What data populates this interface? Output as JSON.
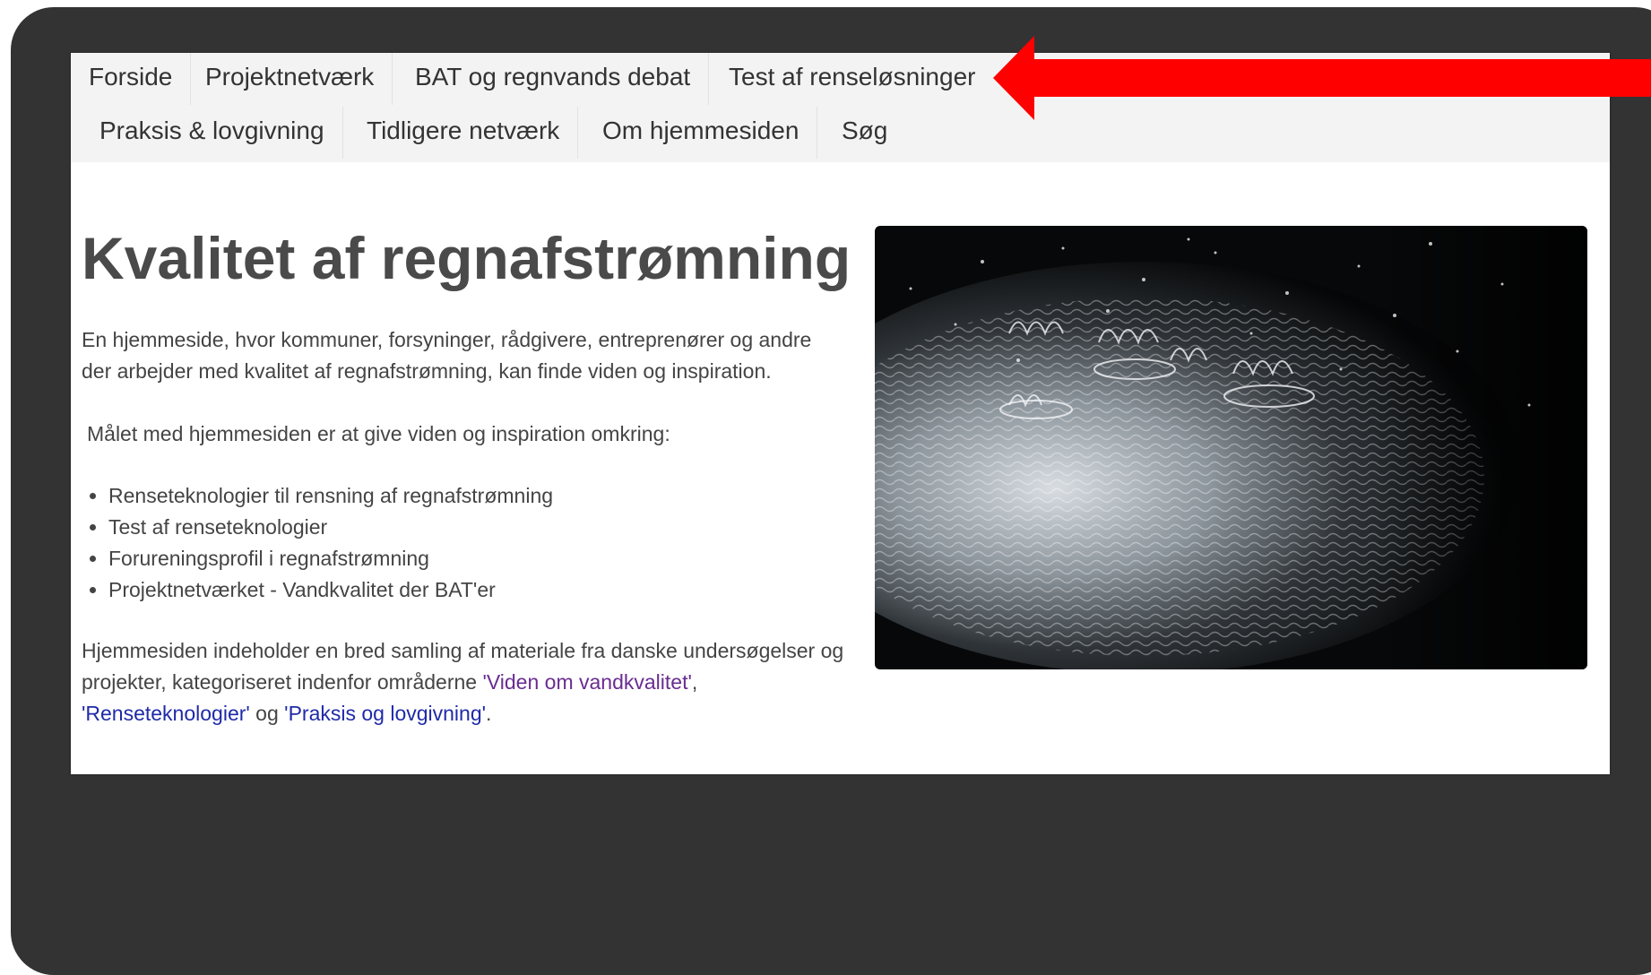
{
  "nav": {
    "row1": [
      "Forside",
      "Projektnetværk",
      "BAT og regnvands debat",
      "Test af renseløsninger"
    ],
    "row2": [
      "Praksis & lovgivning",
      "Tidligere netværk",
      "Om hjemmesiden",
      "Søg"
    ]
  },
  "annotation": {
    "arrow_color": "#ff0000",
    "points_to": "Test af renseløsninger"
  },
  "main": {
    "title": "Kvalitet af regnafstrømning",
    "intro": "En hjemmeside, hvor kommuner, forsyninger, rådgivere, entreprenører og andre der arbejder med kvalitet af regnafstrømning, kan finde viden og inspiration.",
    "goal": "Målet med hjemmesiden er at give viden og inspiration omkring:",
    "bullets": [
      "Renseteknologier til rensning af regnafstrømning",
      "Test af renseteknologier",
      "Forureningsprofil i regnafstrømning",
      "Projektnetværket - Vandkvalitet der BAT'er"
    ],
    "outro": {
      "text_before": "Hjemmesiden indeholder en bred samling af materiale fra danske undersøgelser og projekter, kategoriseret indenfor områderne ",
      "link1": "'Viden om vandkvalitet'",
      "sep1": ", ",
      "link2": "'Renseteknologier'",
      "sep2": " og ",
      "link3": "'Praksis og lovgivning'",
      "end": "."
    }
  },
  "colors": {
    "frame": "#333333",
    "navbar": "#f3f3f3",
    "text": "#444444",
    "link": "#1f2aa8",
    "link_visited": "#6a2c91"
  }
}
